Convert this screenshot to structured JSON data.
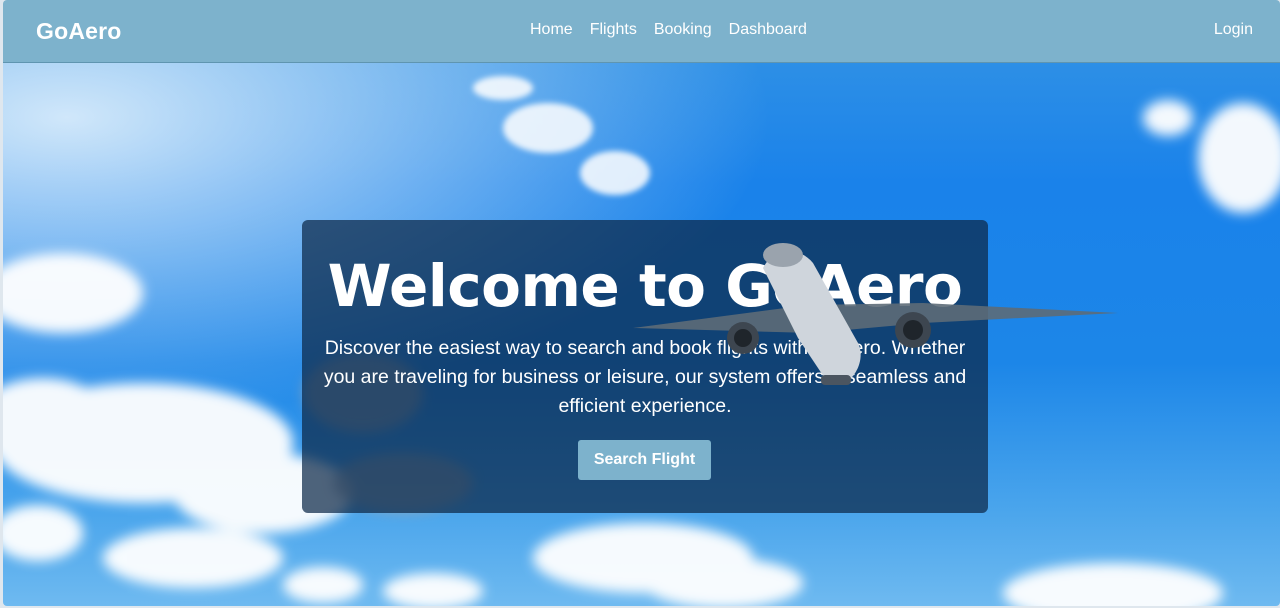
{
  "navbar": {
    "brand": "GoAero",
    "links": [
      "Home",
      "Flights",
      "Booking",
      "Dashboard"
    ],
    "login": "Login",
    "color": "#7db2cc"
  },
  "hero": {
    "title": "Welcome to GoAero",
    "text": "Discover the easiest way to search and book flights with GoAero. Whether you are traveling for business or leisure, our system offers a seamless and efficient experience.",
    "button": "Search Flight",
    "background_image": "airplane-in-blue-sky-with-clouds"
  }
}
